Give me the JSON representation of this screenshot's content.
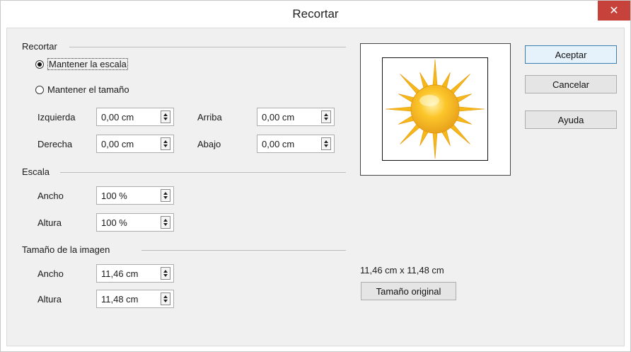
{
  "window": {
    "title": "Recortar",
    "close_glyph": "✕"
  },
  "crop": {
    "section_title": "Recortar",
    "keep_scale": "Mantener la escala",
    "keep_size": "Mantener el tamaño",
    "keep_scale_checked": true,
    "left_label": "Izquierda",
    "left_value": "0,00 cm",
    "right_label": "Derecha",
    "right_value": "0,00 cm",
    "top_label": "Arriba",
    "top_value": "0,00 cm",
    "bottom_label": "Abajo",
    "bottom_value": "0,00 cm"
  },
  "scale": {
    "section_title": "Escala",
    "width_label": "Ancho",
    "width_value": "100 %",
    "height_label": "Altura",
    "height_value": "100 %"
  },
  "image_size": {
    "section_title": "Tamaño de la imagen",
    "width_label": "Ancho",
    "width_value": "11,46 cm",
    "height_label": "Altura",
    "height_value": "11,48 cm",
    "dimensions_text": "11,46 cm x 11,48 cm",
    "original_size_button": "Tamaño original"
  },
  "buttons": {
    "ok": "Aceptar",
    "cancel": "Cancelar",
    "help": "Ayuda"
  },
  "colors": {
    "close_red": "#c7423a",
    "sun_yellow": "#f4b400",
    "sun_orange": "#e8a21c"
  },
  "icons": {
    "preview": "sun-image"
  }
}
